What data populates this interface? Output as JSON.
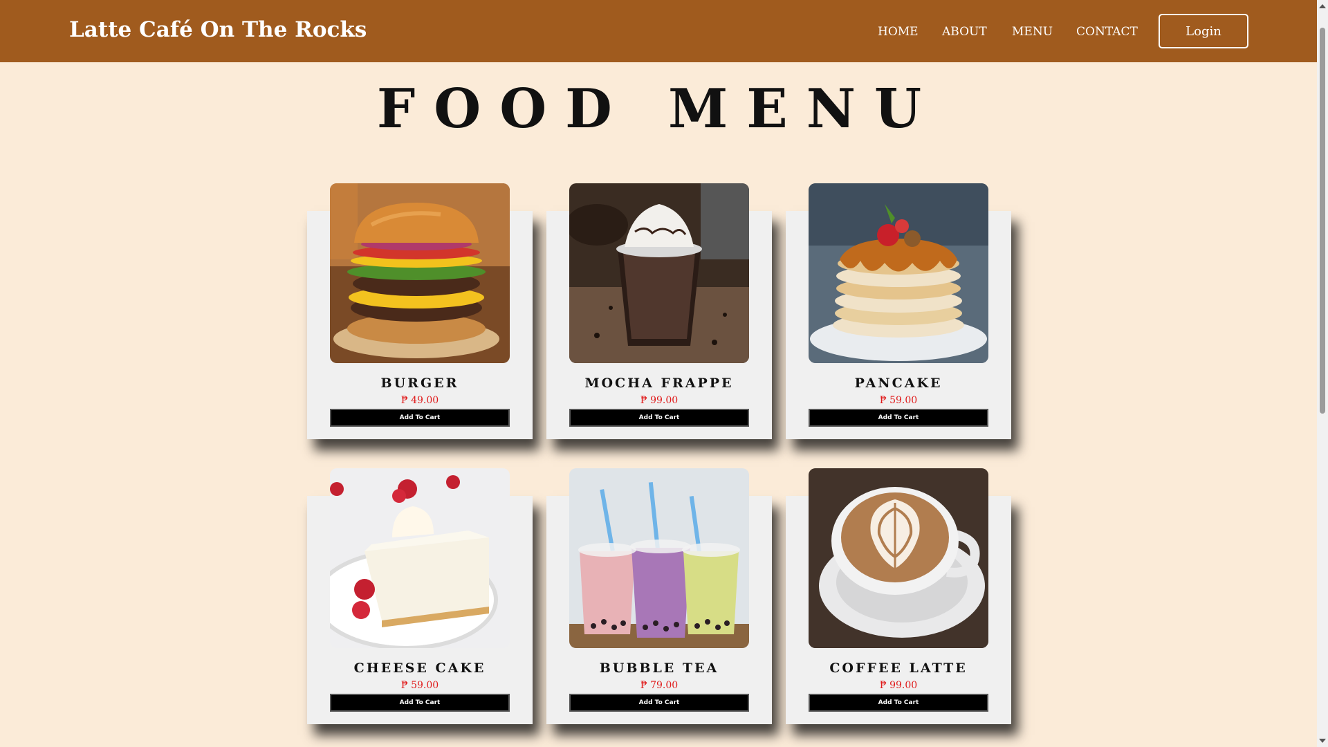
{
  "header": {
    "brand": "Latte Café On The Rocks",
    "nav": [
      "HOME",
      "ABOUT",
      "MENU",
      "CONTACT"
    ],
    "login_label": "Login"
  },
  "page_title": "FOOD MENU",
  "items": [
    {
      "name": "BURGER",
      "price": "₱ 49.00",
      "button": "Add To Cart"
    },
    {
      "name": "MOCHA FRAPPE",
      "price": "₱ 99.00",
      "button": "Add To Cart"
    },
    {
      "name": "PANCAKE",
      "price": "₱ 59.00",
      "button": "Add To Cart"
    },
    {
      "name": "CHEESE CAKE",
      "price": "₱ 59.00",
      "button": "Add To Cart"
    },
    {
      "name": "BUBBLE TEA",
      "price": "₱ 79.00",
      "button": "Add To Cart"
    },
    {
      "name": "COFFEE LATTE",
      "price": "₱ 99.00",
      "button": "Add To Cart"
    }
  ],
  "colors": {
    "navbar": "#a05b1e",
    "background": "#fbebd8",
    "price": "#e01b1b",
    "button": "#000000"
  }
}
